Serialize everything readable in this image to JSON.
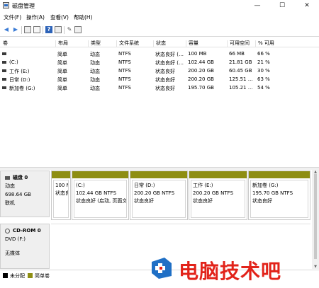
{
  "window": {
    "title": "磁盘管理",
    "minimize": "—",
    "maximize": "☐",
    "close": "✕"
  },
  "menu": [
    "文件(F)",
    "操作(A)",
    "查看(V)",
    "帮助(H)"
  ],
  "volume_table": {
    "columns": [
      "卷",
      "布局",
      "类型",
      "文件系统",
      "状态",
      "容量",
      "可用空间",
      "% 可用"
    ],
    "rows": [
      [
        "",
        "简单",
        "动态",
        "NTFS",
        "状态良好 (…",
        "100 MB",
        "66 MB",
        "66 %"
      ],
      [
        "(C:)",
        "简单",
        "动态",
        "NTFS",
        "状态良好 (…",
        "102.44 GB",
        "21.81 GB",
        "21 %"
      ],
      [
        "工作 (E:)",
        "简单",
        "动态",
        "NTFS",
        "状态良好",
        "200.20 GB",
        "60.45 GB",
        "30 %"
      ],
      [
        "日常 (D:)",
        "简单",
        "动态",
        "NTFS",
        "状态良好",
        "200.20 GB",
        "125.51 …",
        "63 %"
      ],
      [
        "新加卷 (G:)",
        "简单",
        "动态",
        "NTFS",
        "状态良好",
        "195.70 GB",
        "105.21 …",
        "54 %"
      ]
    ]
  },
  "disk0": {
    "name": "磁盘 0",
    "type": "动态",
    "size": "698.64 GB",
    "status": "联机",
    "partitions": [
      {
        "label": "",
        "line1": "100 M",
        "line2": "状态良"
      },
      {
        "label": "(C:)",
        "line1": "102.44 GB NTFS",
        "line2": "状态良好 (启动, 页面文"
      },
      {
        "label": "日常  (D:)",
        "line1": "200.20 GB NTFS",
        "line2": "状态良好"
      },
      {
        "label": "工作  (E:)",
        "line1": "200.20 GB NTFS",
        "line2": "状态良好"
      },
      {
        "label": "新加卷  (G:)",
        "line1": "195.70 GB NTFS",
        "line2": "状态良好"
      }
    ]
  },
  "cdrom0": {
    "name": "CD-ROM 0",
    "type": "DVD (F:)",
    "status": "无媒体"
  },
  "legend": [
    {
      "label": "未分配",
      "color": "#000000"
    },
    {
      "label": "简单卷",
      "color": "#8e8e12"
    }
  ],
  "watermark": {
    "text": "电脑技术吧"
  },
  "colors": {
    "simple_volume": "#8e8e12",
    "watermark_red": "#e2231a",
    "watermark_blue": "#1f6fc5"
  }
}
